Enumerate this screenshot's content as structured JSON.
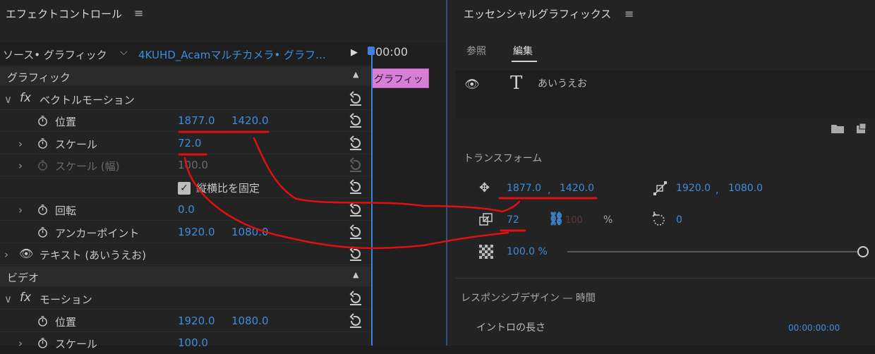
{
  "effect_controls": {
    "title": "エフェクトコントロール",
    "source_label": "ソース• グラフィック",
    "clip_label": "4KUHD_Acamマルチカメラ• グラフ…",
    "timecode": "00:00",
    "clip_bar_label": "グラフィッ",
    "section_graphic": "グラフィック",
    "vector_motion": "ベクトルモーション",
    "position_label": "位置",
    "position_x": "1877.0",
    "position_y": "1420.0",
    "scale_label": "スケール",
    "scale_value": "72.0",
    "scale_width_label": "スケール (幅)",
    "scale_width_value": "100.0",
    "uniform_scale_label": "縦横比を固定",
    "rotation_label": "回転",
    "rotation_value": "0.0",
    "anchor_label": "アンカーポイント",
    "anchor_x": "1920.0",
    "anchor_y": "1080.0",
    "text_layer_label": "テキスト (あいうえお)",
    "section_video": "ビデオ",
    "motion_label": "モーション",
    "motion_position_label": "位置",
    "motion_position_x": "1920.0",
    "motion_position_y": "1080.0",
    "motion_scale_label": "スケール",
    "motion_scale_value": "100.0"
  },
  "essential_graphics": {
    "title": "エッセンシャルグラフィックス",
    "tab_browse": "参照",
    "tab_edit": "編集",
    "layer_text": "あいうえお",
    "transform_label": "トランスフォーム",
    "pos_x": "1877.0",
    "pos_sep": ",",
    "pos_y": "1420.0",
    "anchor_x": "1920.0",
    "anchor_sep": ",",
    "anchor_y": "1080.0",
    "scale": "72",
    "scale_width": "100",
    "percent": "%",
    "rotation": "0",
    "opacity": "100.0 %",
    "responsive_design": "レスポンシブデザイン — 時間",
    "intro_label": "イントロの長さ",
    "intro_value": "00:00:00:00"
  },
  "colors": {
    "accent_blue": "#3e8ddd",
    "annotation_red": "#e01010",
    "clip_pink": "#d77fd6"
  }
}
